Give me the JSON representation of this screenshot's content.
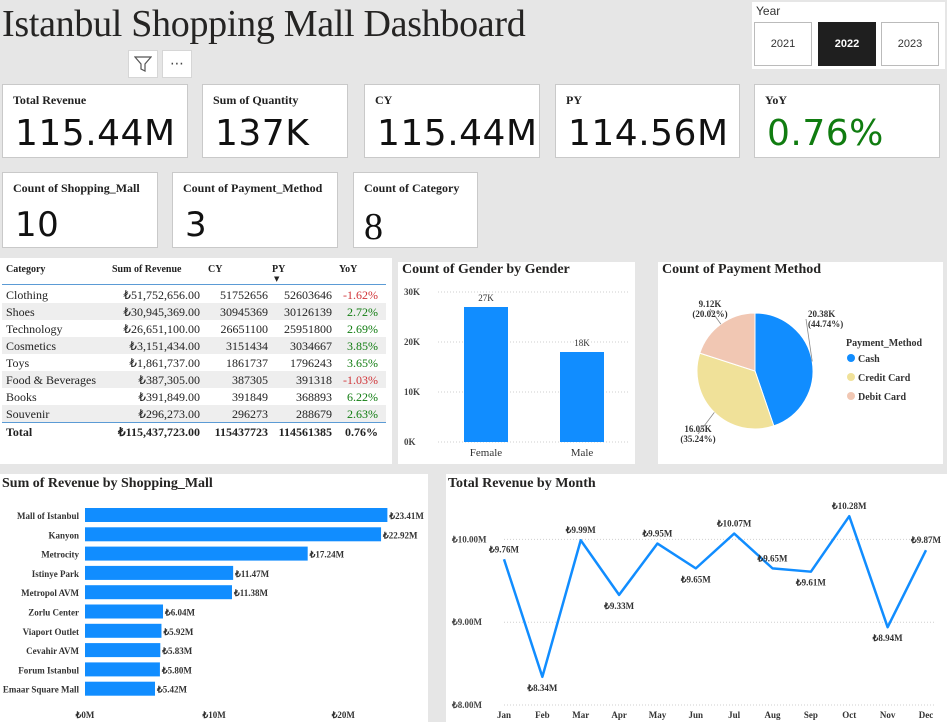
{
  "header": {
    "title": "Istanbul Shopping Mall Dashboard"
  },
  "toolbar": {
    "filter_icon": "filter-icon",
    "more_icon": "more-options-icon",
    "more_glyph": "⋯"
  },
  "year_slicer": {
    "label": "Year",
    "options": [
      "2021",
      "2022",
      "2023"
    ],
    "selected": "2022"
  },
  "kpis": {
    "total_revenue": {
      "label": "Total Revenue",
      "value": "115.44M"
    },
    "sum_quantity": {
      "label": "Sum of Quantity",
      "value": "137K"
    },
    "cy": {
      "label": "CY",
      "value": "115.44M"
    },
    "py": {
      "label": "PY",
      "value": "114.56M"
    },
    "yoy": {
      "label": "YoY",
      "value": "0.76%",
      "color": "#107c10"
    },
    "count_mall": {
      "label": "Count of Shopping_Mall",
      "value": "10"
    },
    "count_payment": {
      "label": "Count of Payment_Method",
      "value": "3"
    },
    "count_category": {
      "label": "Count of Category",
      "value": "8"
    }
  },
  "category_table": {
    "columns": [
      "Category",
      "Sum of Revenue",
      "CY",
      "PY",
      "YoY"
    ],
    "rows": [
      [
        "Clothing",
        "₺51,752,656.00",
        "51752656",
        "52603646",
        "-1.62%"
      ],
      [
        "Shoes",
        "₺30,945,369.00",
        "30945369",
        "30126139",
        "2.72%"
      ],
      [
        "Technology",
        "₺26,651,100.00",
        "26651100",
        "25951800",
        "2.69%"
      ],
      [
        "Cosmetics",
        "₺3,151,434.00",
        "3151434",
        "3034667",
        "3.85%"
      ],
      [
        "Toys",
        "₺1,861,737.00",
        "1861737",
        "1796243",
        "3.65%"
      ],
      [
        "Food & Beverages",
        "₺387,305.00",
        "387305",
        "391318",
        "-1.03%"
      ],
      [
        "Books",
        "₺391,849.00",
        "391849",
        "368893",
        "6.22%"
      ],
      [
        "Souvenir",
        "₺296,273.00",
        "296273",
        "288679",
        "2.63%"
      ]
    ],
    "total": [
      "Total",
      "₺115,437,723.00",
      "115437723",
      "114561385",
      "0.76%"
    ],
    "neg_color": "#d13438",
    "pos_color": "#107c10"
  },
  "chart_data": [
    {
      "type": "bar",
      "title": "Count of Gender by Gender",
      "categories": [
        "Female",
        "Male"
      ],
      "values": [
        27000,
        18000
      ],
      "data_labels": [
        "27K",
        "18K"
      ],
      "ylim": [
        0,
        30000
      ],
      "yticks": [
        "0K",
        "10K",
        "20K",
        "30K"
      ],
      "color": "#118dff",
      "grid": true
    },
    {
      "type": "pie",
      "title": "Count of Payment Method",
      "legend_title": "Payment_Method",
      "legend_position": "right",
      "slices": [
        {
          "name": "Cash",
          "value": 20380,
          "label": "20.38K",
          "pct": "(44.74%)",
          "color": "#118dff"
        },
        {
          "name": "Credit Card",
          "value": 16050,
          "label": "16.05K",
          "pct": "(35.24%)",
          "color": "#f0e199"
        },
        {
          "name": "Debit Card",
          "value": 9120,
          "label": "9.12K",
          "pct": "(20.02%)",
          "color": "#f1c7b3"
        }
      ]
    },
    {
      "type": "bar",
      "orientation": "horizontal",
      "title": "Sum of Revenue by Shopping_Mall",
      "categories": [
        "Mall of Istanbul",
        "Kanyon",
        "Metrocity",
        "Istinye Park",
        "Metropol AVM",
        "Zorlu Center",
        "Viaport Outlet",
        "Cevahir AVM",
        "Forum Istanbul",
        "Emaar Square Mall"
      ],
      "values": [
        23.41,
        22.92,
        17.24,
        11.47,
        11.38,
        6.04,
        5.92,
        5.83,
        5.8,
        5.42
      ],
      "data_labels": [
        "₺23.41M",
        "₺22.92M",
        "₺17.24M",
        "₺11.47M",
        "₺11.38M",
        "₺6.04M",
        "₺5.92M",
        "₺5.83M",
        "₺5.80M",
        "₺5.42M"
      ],
      "xlim": [
        0,
        24
      ],
      "xticks": [
        "₺0M",
        "₺10M",
        "₺20M"
      ],
      "color": "#118dff"
    },
    {
      "type": "line",
      "title": "Total Revenue by Month",
      "x": [
        "Jan",
        "Feb",
        "Mar",
        "Apr",
        "May",
        "Jun",
        "Jul",
        "Aug",
        "Sep",
        "Oct",
        "Nov",
        "Dec"
      ],
      "y": [
        9.76,
        8.34,
        9.99,
        9.33,
        9.95,
        9.65,
        10.07,
        9.65,
        9.61,
        10.28,
        8.94,
        9.87
      ],
      "data_labels": [
        "₺9.76M",
        "₺8.34M",
        "₺9.99M",
        "₺9.33M",
        "₺9.95M",
        "₺9.65M",
        "₺10.07M",
        "₺9.65M",
        "₺9.61M",
        "₺10.28M",
        "₺8.94M",
        "₺9.87M"
      ],
      "ylim": [
        8.0,
        10.5
      ],
      "yticks": [
        "₺8.00M",
        "₺9.00M",
        "₺10.00M"
      ],
      "color": "#118dff",
      "grid": true
    }
  ]
}
